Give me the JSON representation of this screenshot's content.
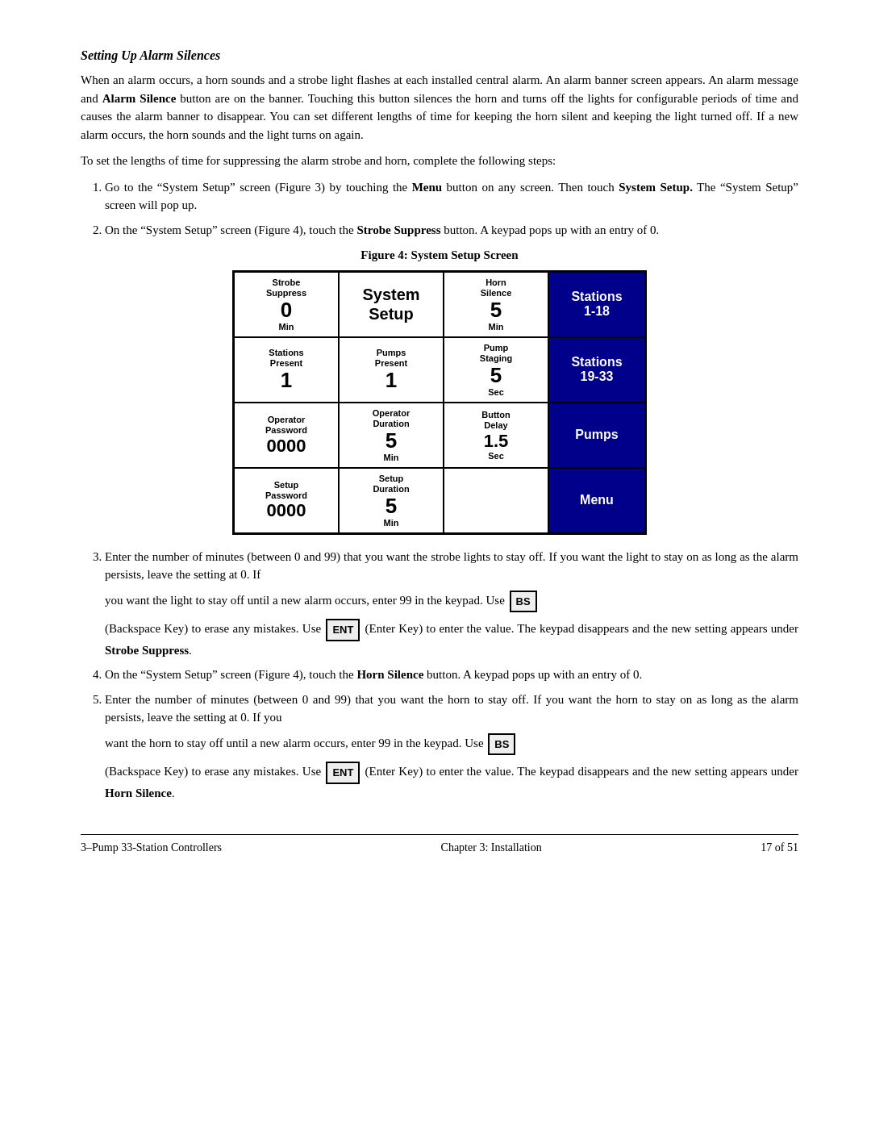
{
  "section": {
    "title": "Setting Up Alarm Silences"
  },
  "paragraphs": {
    "p1": "When an alarm occurs, a horn sounds and a strobe light flashes at each installed central alarm. An alarm banner screen appears.  An alarm message and Alarm Silence button are on the banner.  Touching this button silences the horn and turns off the lights for configurable periods of time and causes the alarm banner to disappear.  You can set different lengths of time for keeping the horn silent and keeping the light turned off.  If a new alarm occurs, the horn sounds and the light turns on again.",
    "p2": "To set the lengths of time for suppressing the alarm strobe and horn, complete the following steps:"
  },
  "steps": [
    "Go to the “System Setup” screen (Figure 3) by touching the Menu button on any screen. Then touch System Setup.  The “System Setup” screen will pop up.",
    "On the “System Setup” screen (Figure 4), touch the Strobe Suppress button. A keypad pops up with an entry of 0."
  ],
  "figure_caption": "Figure 4: System Setup Screen",
  "grid": {
    "cells": [
      {
        "label": "Strobe\nSuppress",
        "value": "0",
        "unit": "Min",
        "type": "normal"
      },
      {
        "label": "",
        "value": "System\nSetup",
        "unit": "",
        "type": "center"
      },
      {
        "label": "Horn\nSilence",
        "value": "5",
        "unit": "Min",
        "type": "normal"
      },
      {
        "label": "Stations\n1-18",
        "value": "",
        "unit": "",
        "type": "blue"
      },
      {
        "label": "Stations\nPresent",
        "value": "1",
        "unit": "",
        "type": "normal"
      },
      {
        "label": "Pumps\nPresent",
        "value": "1",
        "unit": "",
        "type": "normal"
      },
      {
        "label": "Pump\nStaging",
        "value": "5",
        "unit": "Sec",
        "type": "normal"
      },
      {
        "label": "Stations\n19-33",
        "value": "",
        "unit": "",
        "type": "blue"
      },
      {
        "label": "Operator\nPassword",
        "value": "0000",
        "unit": "",
        "type": "normal"
      },
      {
        "label": "Operator\nDuration",
        "value": "5",
        "unit": "Min",
        "type": "normal"
      },
      {
        "label": "Button\nDelay",
        "value": "1.5",
        "unit": "Sec",
        "type": "normal"
      },
      {
        "label": "Pumps",
        "value": "",
        "unit": "",
        "type": "blue"
      },
      {
        "label": "Setup\nPassword",
        "value": "0000",
        "unit": "",
        "type": "normal"
      },
      {
        "label": "Setup\nDuration",
        "value": "5",
        "unit": "Min",
        "type": "normal"
      },
      {
        "label": "",
        "value": "",
        "unit": "",
        "type": "empty"
      },
      {
        "label": "Menu",
        "value": "",
        "unit": "",
        "type": "blue"
      }
    ]
  },
  "steps_continued": [
    "Enter the number of minutes (between 0 and 99) that you want the strobe lights to stay off.  If you want the light to stay on as long as the alarm persists, leave the setting at 0.  If",
    "you want the light to stay off until a new alarm occurs, enter 99 in the keypad.  Use",
    "(Backspace Key) to erase any mistakes.  Use       (Enter Key) to enter the value.  The keypad disappears and the new setting appears under Strobe Suppress.",
    "On the “System Setup” screen (Figure 4), touch the Horn Silence button.  A keypad pops up with an entry of 0.",
    "Enter the number of minutes (between 0 and 99) that you want the horn to stay off.  If you want the horn to stay on as long as the alarm persists, leave the setting at 0.  If you",
    "want the horn to stay off until a new alarm occurs, enter 99 in the keypad.  Use",
    "(Backspace Key) to erase any mistakes.  Use       (Enter Key)  to enter the value.  The keypad disappears and the new setting appears under Horn Silence."
  ],
  "footer": {
    "left": "3–Pump 33-Station Controllers",
    "center": "Chapter 3:  Installation",
    "right": "17 of 51"
  },
  "buttons": {
    "bs": "BS",
    "ent": "ENT"
  }
}
